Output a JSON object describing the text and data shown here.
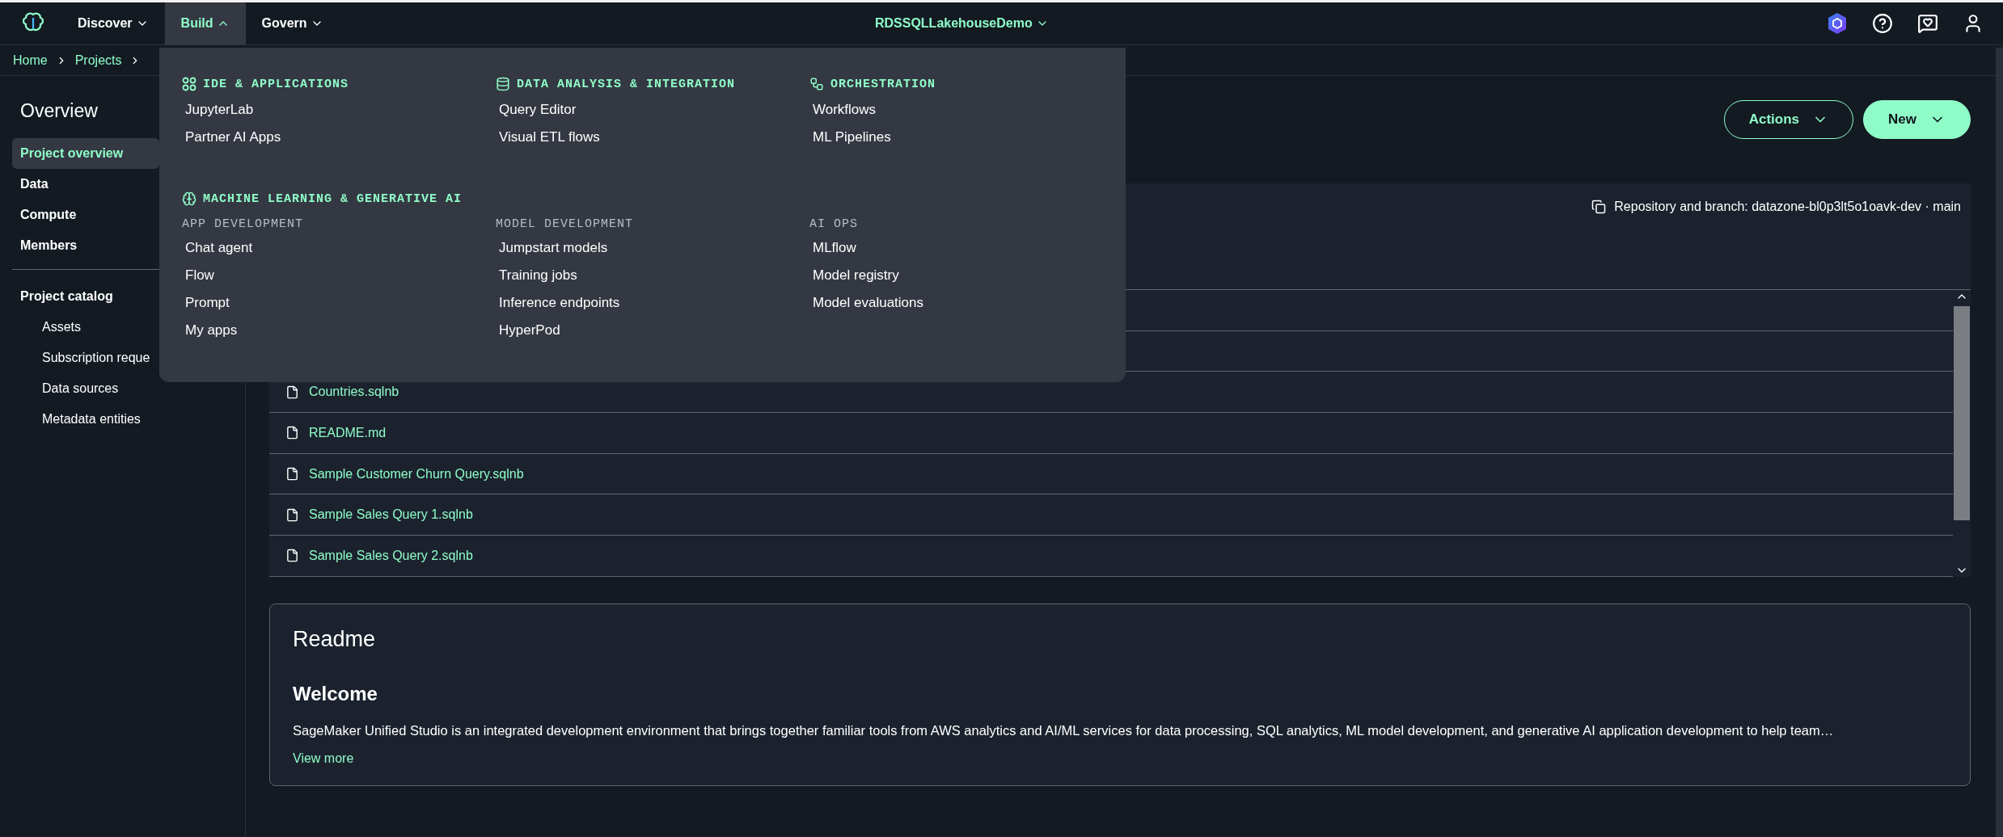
{
  "top_nav": {
    "items": [
      {
        "label": "Discover",
        "selected": false,
        "expanded": false
      },
      {
        "label": "Build",
        "selected": true,
        "expanded": true
      },
      {
        "label": "Govern",
        "selected": false,
        "expanded": false
      }
    ],
    "project": "RDSSQLLakehouseDemo"
  },
  "breadcrumbs": [
    "Home",
    "Projects"
  ],
  "sidebar": {
    "title": "Overview",
    "items": [
      {
        "label": "Project overview",
        "selected": true
      },
      {
        "label": "Data",
        "selected": false
      },
      {
        "label": "Compute",
        "selected": false
      },
      {
        "label": "Members",
        "selected": false
      }
    ],
    "catalog": {
      "title": "Project catalog",
      "items": [
        {
          "label": "Assets",
          "selected": false
        },
        {
          "label": "Subscription reque",
          "selected": false
        },
        {
          "label": "Data sources",
          "selected": false
        },
        {
          "label": "Metadata entities",
          "selected": false
        }
      ]
    }
  },
  "build_menu": {
    "sections": [
      {
        "kind": "apps",
        "title": "IDE & APPLICATIONS",
        "items": [
          "JupyterLab",
          "Partner AI Apps"
        ]
      },
      {
        "kind": "database",
        "title": "DATA ANALYSIS & INTEGRATION",
        "items": [
          "Query Editor",
          "Visual ETL flows"
        ]
      },
      {
        "kind": "workflow",
        "title": "ORCHESTRATION",
        "items": [
          "Workflows",
          "ML Pipelines"
        ]
      }
    ],
    "ml_section": {
      "title": "MACHINE LEARNING & GENERATIVE AI",
      "groups": [
        {
          "title": "APP DEVELOPMENT",
          "items": [
            "Chat agent",
            "Flow",
            "Prompt",
            "My apps"
          ]
        },
        {
          "title": "MODEL DEVELOPMENT",
          "items": [
            "Jumpstart models",
            "Training jobs",
            "Inference endpoints",
            "HyperPod"
          ]
        },
        {
          "title": "AI OPS",
          "items": [
            "MLflow",
            "Model registry",
            "Model evaluations"
          ]
        }
      ]
    }
  },
  "actions": [
    {
      "label": "Actions",
      "kind": "outline"
    },
    {
      "label": "New",
      "kind": "primary"
    }
  ],
  "repository": {
    "label": "Repository and branch: datazone-bl0p3lt5o1oavk-dev · main",
    "files": [
      "Countries.sqlnb",
      "README.md",
      "Sample Customer Churn Query.sqlnb",
      "Sample Sales Query 1.sqlnb",
      "Sample Sales Query 2.sqlnb"
    ]
  },
  "readme": {
    "title": "Readme",
    "heading": "Welcome",
    "text": "SageMaker Unified Studio is an integrated development environment that brings together familiar tools from AWS analytics and AI/ML services for data processing, SQL analytics, ML model development, and generative AI application development to help team…",
    "link": "View more"
  }
}
